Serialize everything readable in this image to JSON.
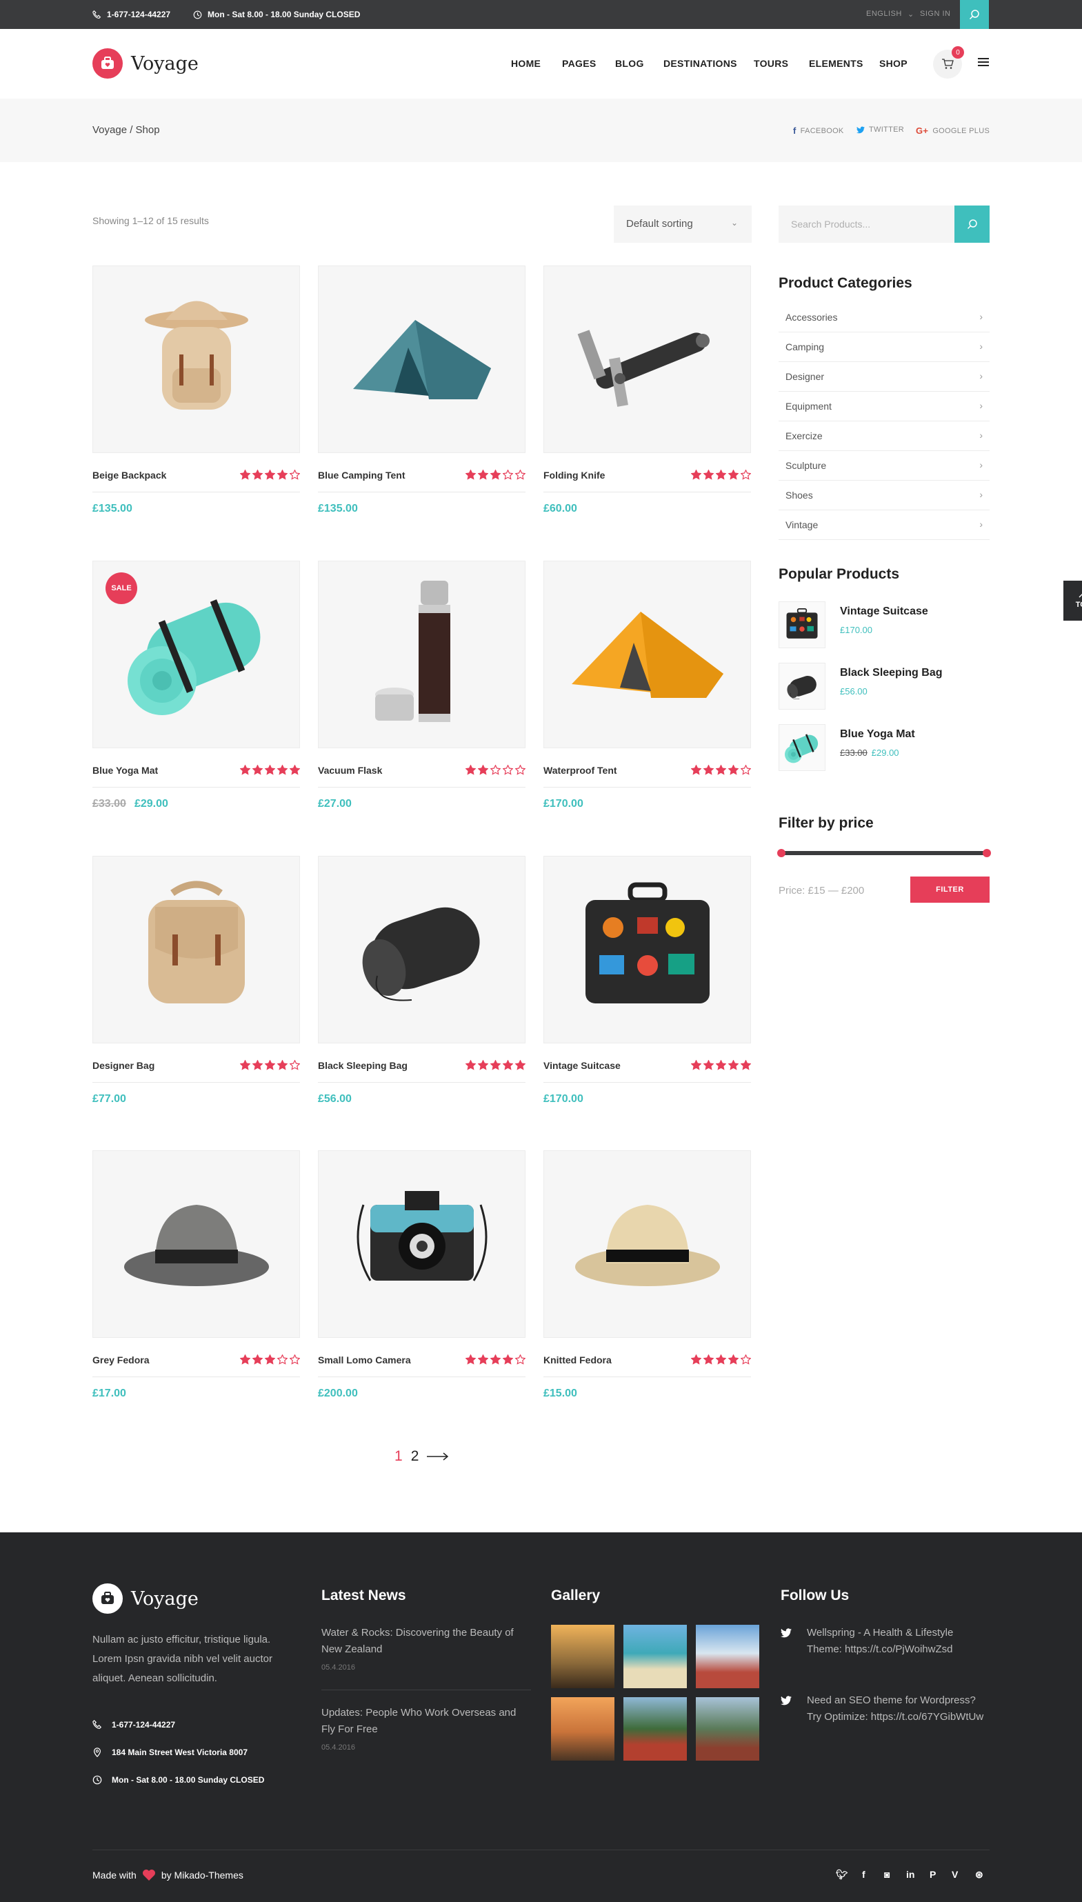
{
  "topbar": {
    "phone": "1-677-124-44227",
    "hours": "Mon - Sat 8.00 - 18.00 Sunday CLOSED",
    "language": "ENGLISH",
    "signin": "SIGN IN"
  },
  "header": {
    "logo": "Voyage",
    "nav": [
      "HOME",
      "PAGES",
      "BLOG",
      "DESTINATIONS",
      "TOURS",
      "ELEMENTS",
      "SHOP"
    ],
    "cart_count": "0"
  },
  "titlebar": {
    "breadcrumb": "Voyage / Shop",
    "social": [
      "FACEBOOK",
      "TWITTER",
      "GOOGLE PLUS"
    ]
  },
  "shop": {
    "results": "Showing 1–12 of 15 results",
    "sorting": "Default sorting",
    "products": [
      {
        "title": "Beige Backpack",
        "price": "£135.00",
        "old_price": "",
        "rating": 4,
        "sale": false,
        "icon": "backpack"
      },
      {
        "title": "Blue Camping Tent",
        "price": "£135.00",
        "old_price": "",
        "rating": 3,
        "sale": false,
        "icon": "tent-blue"
      },
      {
        "title": "Folding Knife",
        "price": "£60.00",
        "old_price": "",
        "rating": 4,
        "sale": false,
        "icon": "knife"
      },
      {
        "title": "Blue Yoga Mat",
        "price": "£29.00",
        "old_price": "£33.00",
        "rating": 5,
        "sale": true,
        "icon": "yoga-mat"
      },
      {
        "title": "Vacuum Flask",
        "price": "£27.00",
        "old_price": "",
        "rating": 2,
        "sale": false,
        "icon": "flask"
      },
      {
        "title": "Waterproof Tent",
        "price": "£170.00",
        "old_price": "",
        "rating": 4,
        "sale": false,
        "icon": "tent-orange"
      },
      {
        "title": "Designer Bag",
        "price": "£77.00",
        "old_price": "",
        "rating": 4,
        "sale": false,
        "icon": "bag"
      },
      {
        "title": "Black Sleeping Bag",
        "price": "£56.00",
        "old_price": "",
        "rating": 5,
        "sale": false,
        "icon": "sleeping-bag"
      },
      {
        "title": "Vintage Suitcase",
        "price": "£170.00",
        "old_price": "",
        "rating": 5,
        "sale": false,
        "icon": "suitcase"
      },
      {
        "title": "Grey Fedora",
        "price": "£17.00",
        "old_price": "",
        "rating": 3,
        "sale": false,
        "icon": "fedora-grey"
      },
      {
        "title": "Small Lomo Camera",
        "price": "£200.00",
        "old_price": "",
        "rating": 4,
        "sale": false,
        "icon": "camera"
      },
      {
        "title": "Knitted Fedora",
        "price": "£15.00",
        "old_price": "",
        "rating": 4,
        "sale": false,
        "icon": "fedora-straw"
      }
    ],
    "sale_label": "SALE",
    "pagination": [
      "1",
      "2"
    ]
  },
  "sidebar": {
    "search_placeholder": "Search Products...",
    "categories_title": "Product Categories",
    "categories": [
      "Accessories",
      "Camping",
      "Designer",
      "Equipment",
      "Exercize",
      "Sculpture",
      "Shoes",
      "Vintage"
    ],
    "popular_title": "Popular Products",
    "popular": [
      {
        "title": "Vintage Suitcase",
        "price": "£170.00",
        "old_price": ""
      },
      {
        "title": "Black Sleeping Bag",
        "price": "£56.00",
        "old_price": ""
      },
      {
        "title": "Blue Yoga Mat",
        "price": "£29.00",
        "old_price": "£33.00"
      }
    ],
    "filter_title": "Filter by price",
    "price_range": "Price: £15 — £200",
    "filter_button": "FILTER",
    "top_label": "TOP"
  },
  "footer": {
    "logo": "Voyage",
    "about": "Nullam ac justo efficitur, tristique ligula. Lorem Ipsn gravida nibh vel velit auctor aliquet. Aenean sollicitudin.",
    "phone": "1-677-124-44227",
    "address": "184 Main Street West Victoria 8007",
    "hours": "Mon - Sat 8.00 - 18.00 Sunday CLOSED",
    "news_title": "Latest News",
    "news": [
      {
        "title": "Water & Rocks: Discovering the Beauty of New Zealand",
        "date": "05.4.2016"
      },
      {
        "title": "Updates: People Who Work Overseas and Fly For Free",
        "date": "05.4.2016"
      }
    ],
    "gallery_title": "Gallery",
    "follow_title": "Follow Us",
    "tweets": [
      "Wellspring - A Health & Lifestyle Theme: https://t.co/PjWoihwZsd",
      "Need an SEO theme for Wordpress? Try Optimize: https://t.co/67YGibWtUw"
    ],
    "made_with": "Made with",
    "by": "by Mikado-Themes"
  },
  "colors": {
    "accent": "#3fbfbd",
    "brand": "#e63e59",
    "dark": "#262729"
  }
}
